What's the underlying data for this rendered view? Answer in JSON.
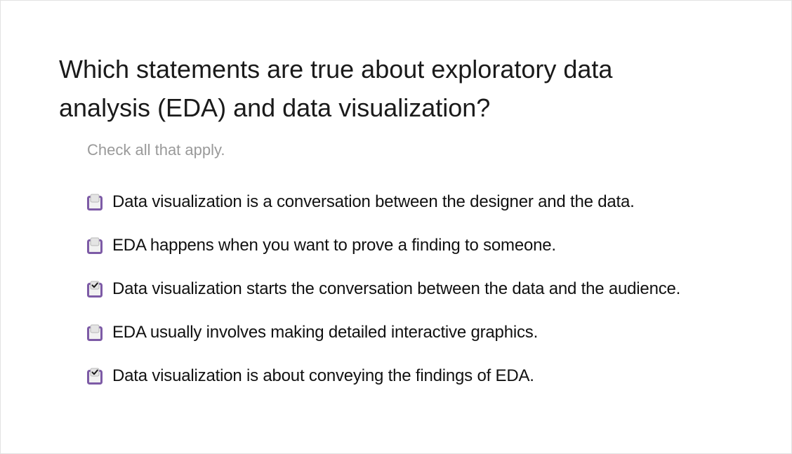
{
  "question": {
    "text_line1": "Which statements are true about exploratory data",
    "text_line2": "analysis (EDA) and data visualization?",
    "instructions": "Check all that apply."
  },
  "options": [
    {
      "label": "Data visualization is a conversation between the designer and the data.",
      "checked": false
    },
    {
      "label": "EDA happens when you want to prove a finding to someone.",
      "checked": false
    },
    {
      "label": "Data visualization starts the conversation between the data and the audience.",
      "checked": true
    },
    {
      "label": "EDA usually involves making detailed interactive graphics.",
      "checked": false
    },
    {
      "label": "Data visualization is about conveying the findings of EDA.",
      "checked": true
    }
  ],
  "colors": {
    "checkbox_border": "#7d5ba6",
    "checkbox_fill": "#f1f1f1",
    "checkbox_tab": "#e4e4e4",
    "checkmark": "#1a1a1a",
    "instructions_text": "#9a9a9a"
  },
  "icons": {
    "unchecked": "checkbox-unchecked-icon",
    "checked": "checkbox-checked-icon"
  }
}
